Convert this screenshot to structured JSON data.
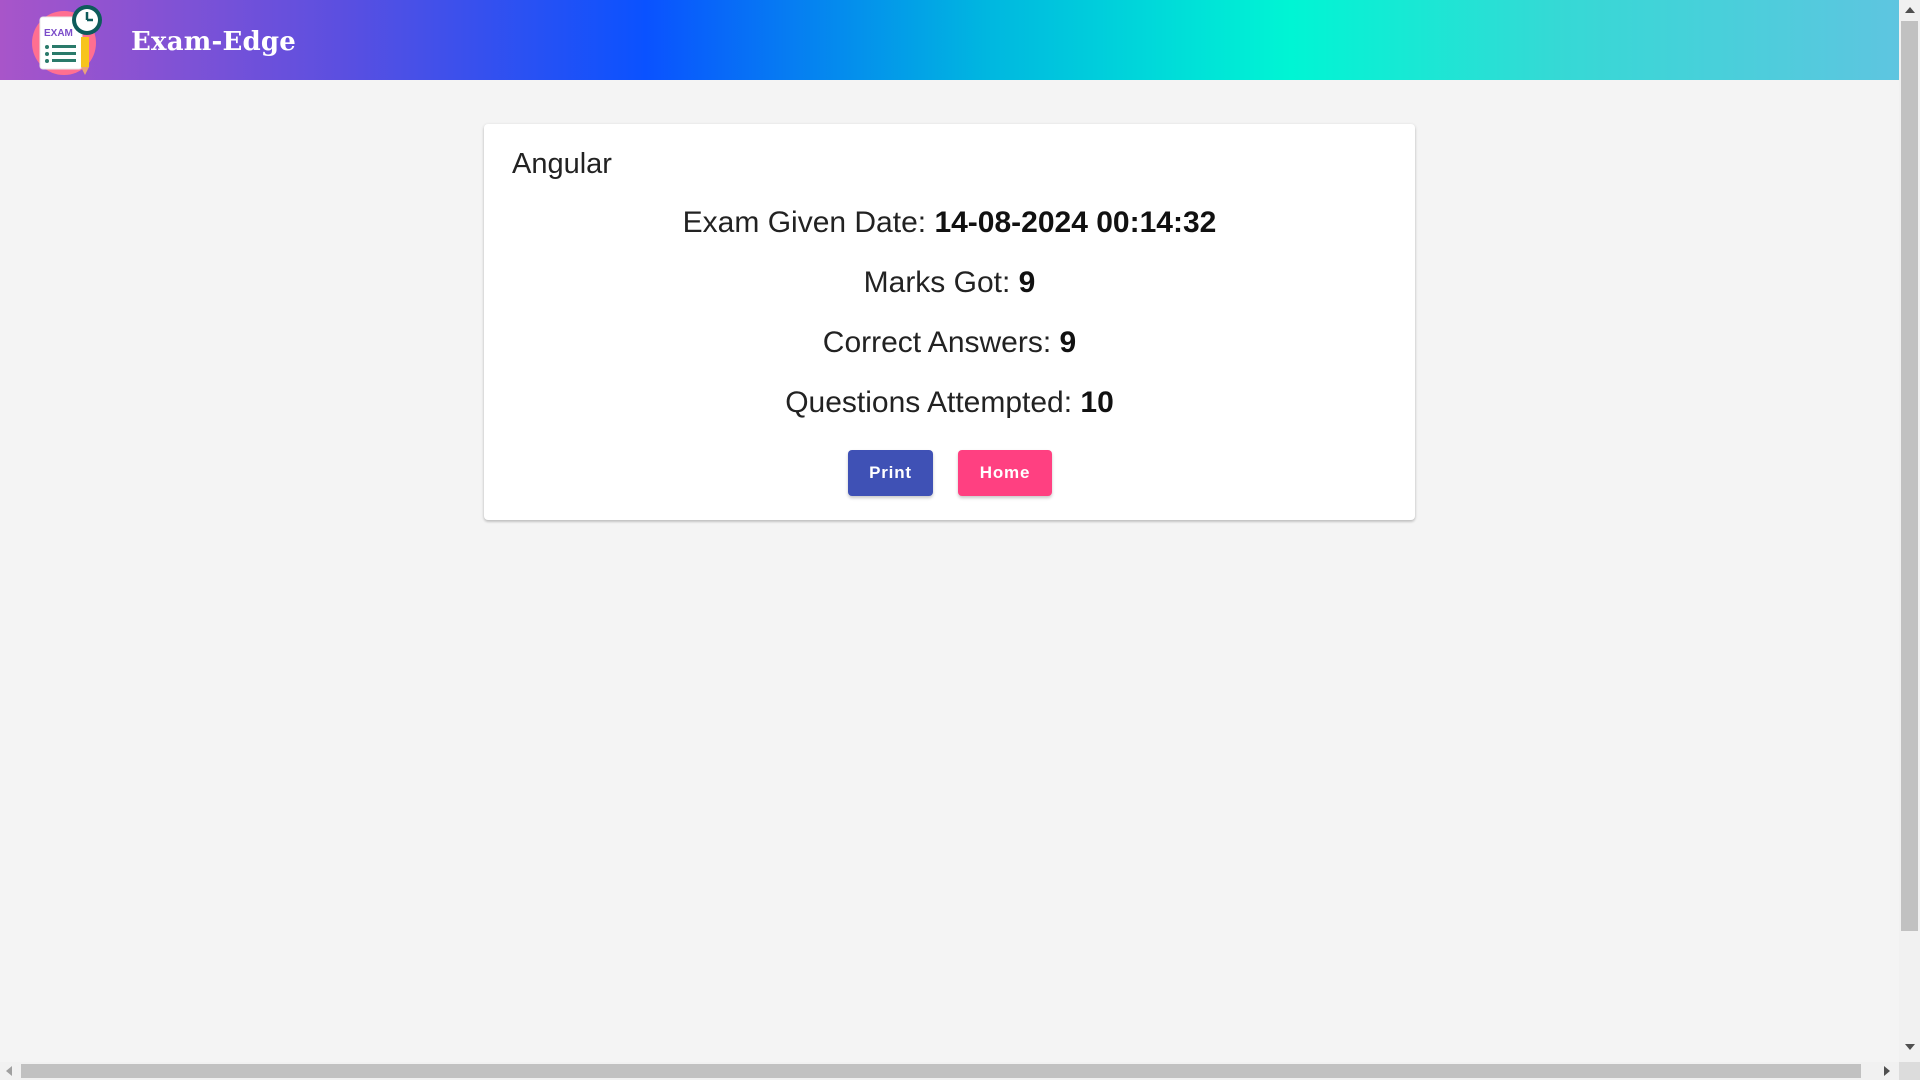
{
  "header": {
    "app_name": "Exam-Edge",
    "logo_text": "EXAM",
    "logo_icon": "exam-clipboard-clock-icon"
  },
  "result": {
    "exam_title": "Angular",
    "date_label": "Exam Given Date: ",
    "date_value": "14-08-2024 00:14:32",
    "marks_label": "Marks Got: ",
    "marks_value": "9",
    "correct_label": "Correct Answers: ",
    "correct_value": "9",
    "attempted_label": "Questions Attempted: ",
    "attempted_value": "10"
  },
  "actions": {
    "print_label": "Print",
    "home_label": "Home"
  },
  "colors": {
    "primary": "#3f51b5",
    "accent": "#ff4081",
    "background": "#f4f4f4"
  }
}
